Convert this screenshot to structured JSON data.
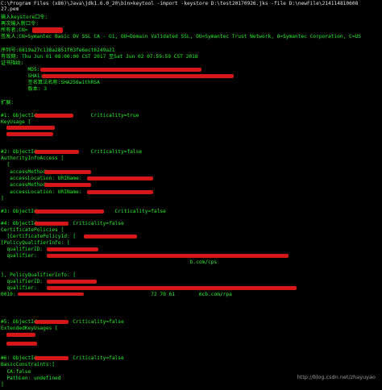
{
  "console": {
    "lines": [
      "C:\\Program Files (x86)\\Java\\jdk1.6.0_20\\bin>keytool -import -keystore D:\\test20170926.jks -file D:\\newFile\\214114810608",
      "27.pem",
      "输入keystore口令:",
      "再次输入新口令:",
      "所有者:CN=",
      "签发人:CN=Symantec Basic DV SSL CA - G1, OU=Domain Validated SSL, OU=Symantec Trust Network, O=Symantec Corporation, C=US",
      "序列号:6819a27c138a2851f03fe6ect6249a21",
      "有效期: Thu Jun 01 08:00:00 CST 2017 至Sat Jun 02 07:59:59 CST 2018",
      "证书指纹:",
      "         MD5:",
      "         SHA1:",
      "         签名算法名称:SHA256withRSA",
      "         版本: 3",
      "",
      "扩展:",
      "",
      "#1: ObjectId:                 Criticality=true",
      "KeyUsage [",
      "",
      "",
      "",
      "#2: ObjectId:                 Criticality=false",
      "AuthorityInfoAccess [",
      "  [",
      "   accessMethod:",
      "   accessLocation: URIName:",
      "   accessMethod:",
      "   accessLocation: URIName:",
      "]",
      "",
      "#3: ObjectId:                         Criticality=false",
      "",
      "#4: ObjectId:           Criticality=false",
      "CertificatePolicies [",
      "  [CertificatePolicyId: [",
      "[PolicyQualifierInfo: [",
      "  qualifierID:",
      "  qualifier:",
      "                                                               b.com/cps",
      "",
      "], PolicyQualifierInfo: [",
      "  qualifierID:",
      "  qualifier:",
      "0010:                                             72 70 61        mcb.com/rpa",
      "",
      "",
      "#5: ObjectId:           Criticality=false",
      "ExtendedKeyUsages [",
      "",
      "",
      "",
      "#6: ObjectId:           Criticality=false",
      "BasicConstraints:[",
      "  CA:false",
      "  PathLen: undefined",
      "]"
    ],
    "watermark": "http://blog.csdn.net/zhayuyao"
  }
}
